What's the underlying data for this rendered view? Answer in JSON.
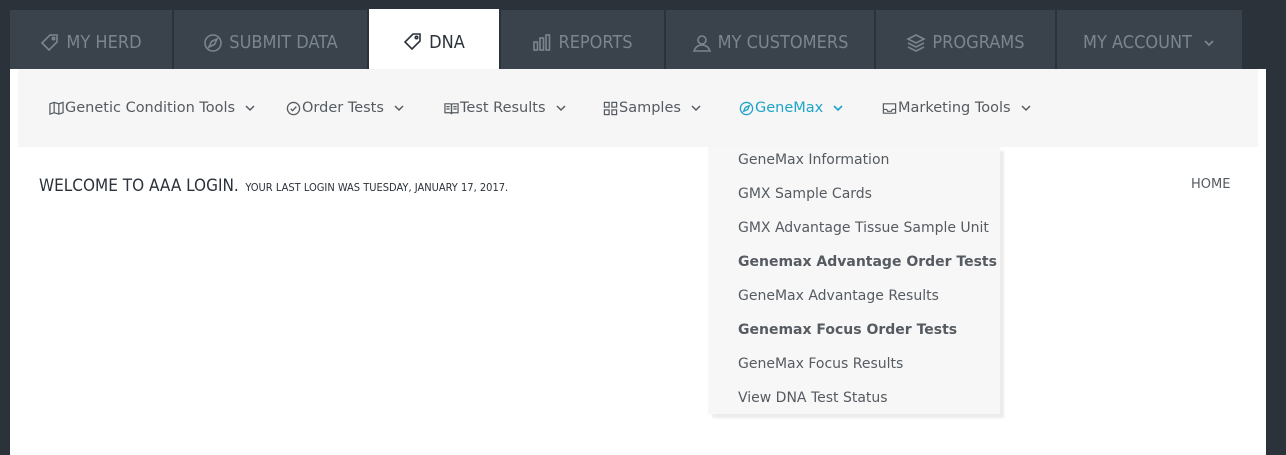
{
  "top_nav": {
    "tabs": [
      {
        "label": "MY HERD",
        "icon": "tag-icon"
      },
      {
        "label": "SUBMIT DATA",
        "icon": "compass-icon"
      },
      {
        "label": "DNA",
        "icon": "tag-icon"
      },
      {
        "label": "REPORTS",
        "icon": "bar-chart-icon"
      },
      {
        "label": "MY CUSTOMERS",
        "icon": "user-icon"
      },
      {
        "label": "PROGRAMS",
        "icon": "layers-icon"
      },
      {
        "label": "MY ACCOUNT",
        "icon": "chevron-down-icon"
      }
    ],
    "active_tab": "DNA"
  },
  "subnav": {
    "items": [
      {
        "label": "Genetic Condition Tools",
        "icon": "map-icon"
      },
      {
        "label": "Order Tests",
        "icon": "check-circle-icon"
      },
      {
        "label": "Test Results",
        "icon": "book-icon"
      },
      {
        "label": "Samples",
        "icon": "grid-icon"
      },
      {
        "label": "GeneMax",
        "icon": "compass-icon"
      },
      {
        "label": "Marketing Tools",
        "icon": "inbox-icon"
      }
    ],
    "active_item": "GeneMax"
  },
  "welcome": {
    "title": "WELCOME TO AAA LOGIN.",
    "last_login": "YOUR LAST LOGIN WAS TUESDAY, JANUARY 17, 2017."
  },
  "breadcrumb": {
    "home": "HOME"
  },
  "genemax_menu": {
    "items": [
      {
        "label": "GeneMax Information",
        "bold": false
      },
      {
        "label": "GMX Sample Cards",
        "bold": false
      },
      {
        "label": "GMX Advantage Tissue Sample Unit",
        "bold": false
      },
      {
        "label": "Genemax Advantage Order Tests",
        "bold": true
      },
      {
        "label": "GeneMax Advantage Results",
        "bold": false
      },
      {
        "label": "Genemax Focus Order Tests",
        "bold": true
      },
      {
        "label": "GeneMax Focus Results",
        "bold": false
      },
      {
        "label": "View DNA Test Status",
        "bold": false
      }
    ]
  },
  "colors": {
    "background": "#2b323a",
    "tab_inactive": "#3a434c",
    "tab_text_inactive": "#7b858e",
    "accent": "#1ea4c8",
    "subnav_bg": "#f6f6f6",
    "text": "#555b61"
  }
}
